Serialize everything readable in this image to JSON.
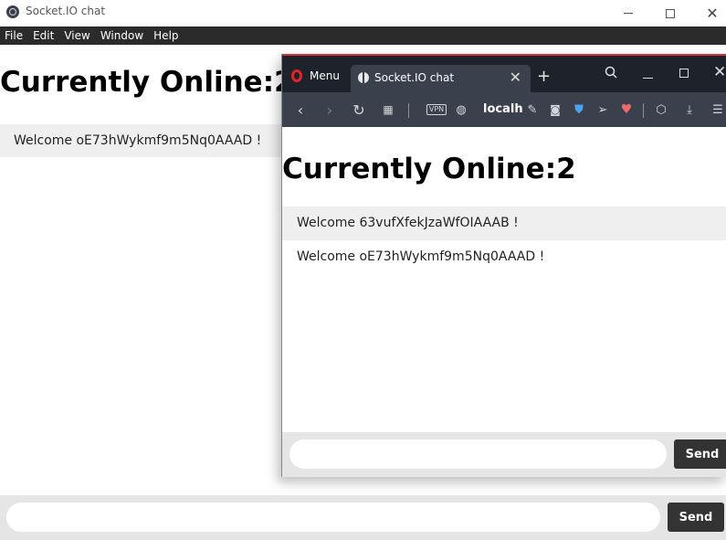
{
  "background_window": {
    "title": "Socket.IO chat",
    "menu": [
      "File",
      "Edit",
      "View",
      "Window",
      "Help"
    ],
    "heading": "Currently Online:2",
    "messages": [
      "Welcome oE73hWykmf9m5Nq0AAAD !"
    ],
    "input": {
      "value": "",
      "placeholder": ""
    },
    "send_label": "Send"
  },
  "browser_window": {
    "menu_label": "Menu",
    "tab_title": "Socket.IO chat",
    "tab_close": "✕",
    "new_tab": "+",
    "toolbar": {
      "vpn_label": "VPN",
      "address": "localh"
    },
    "page": {
      "heading": "Currently Online:2",
      "messages": [
        "Welcome 63vufXfekJzaWfOIAAAB !",
        "Welcome oE73hWykmf9m5Nq0AAAD !"
      ],
      "input": {
        "value": "",
        "placeholder": ""
      },
      "send_label": "Send"
    },
    "accent_color": "#d9323a"
  },
  "icons": [
    "app-icon",
    "minimize-icon",
    "maximize-icon",
    "close-icon",
    "opera-logo-icon",
    "globe-icon",
    "search-icon",
    "back-icon",
    "forward-icon",
    "reload-icon",
    "speed-dial-icon",
    "vpn-icon",
    "world-icon",
    "edit-icon",
    "camera-icon",
    "shield-icon",
    "send-icon",
    "heart-icon",
    "box-icon",
    "download-icon",
    "settings-icon"
  ]
}
